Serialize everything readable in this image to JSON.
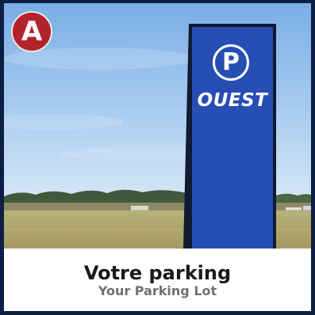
{
  "badge": {
    "letter": "A",
    "color": "#b3232c"
  },
  "sign": {
    "icon": "parking-p-icon",
    "icon_letter": "P",
    "text": "OUEST",
    "color": "#1f47b0"
  },
  "caption": {
    "title": "Votre parking",
    "subtitle": "Your Parking Lot"
  }
}
